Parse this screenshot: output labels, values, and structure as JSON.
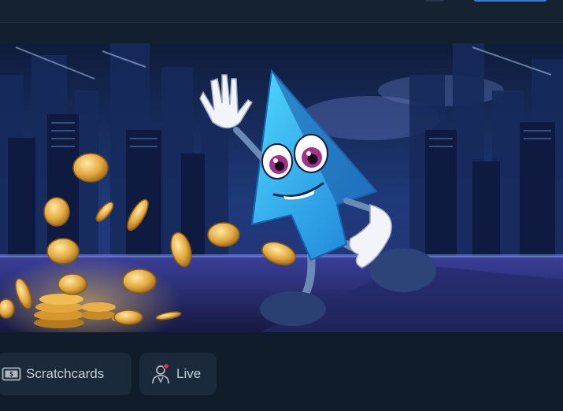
{
  "categories": [
    {
      "label": "Scratchcards",
      "icon": "scratchcard-icon"
    },
    {
      "label": "Live",
      "icon": "live-dealer-icon"
    }
  ],
  "colors": {
    "background": "#101c29",
    "tab_background": "#1a2a3a",
    "tab_text": "#c5ccd4",
    "accent_blue": "#2f7ee6",
    "live_dot": "#e0315b"
  }
}
